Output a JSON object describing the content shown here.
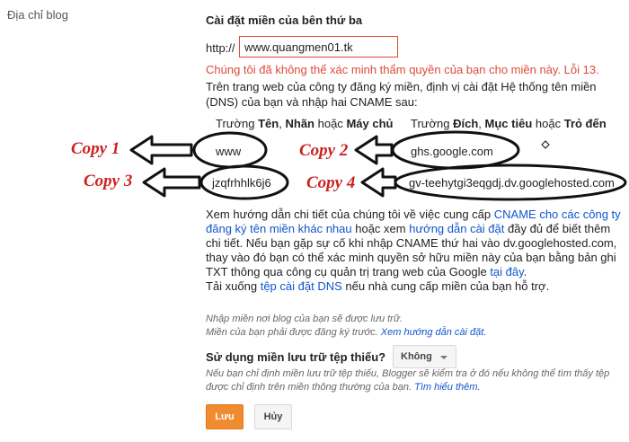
{
  "side_label": "Địa chỉ blog",
  "section_title": "Cài đặt miền của bên thứ ba",
  "http_label": "http://",
  "url_input": {
    "value": "www.quangmen01.tk"
  },
  "error_text": "Chúng tôi đã không thể xác minh thẩm quyền của bạn cho miền này. Lỗi 13.",
  "instructions": "Trên trang web của công ty đăng ký miền, định vị cài đặt Hệ thống tên miền (DNS) của bạn và nhập hai CNAME sau:",
  "table": {
    "col1_prefix": "Trường",
    "col1_b1": "Tên",
    "col1_sep1": ",",
    "col1_b2": "Nhãn",
    "col1_mid": "hoặc",
    "col1_b3": "Máy chủ",
    "col2_prefix": "Trường",
    "col2_b1": "Đích",
    "col2_sep1": ",",
    "col2_b2": "Mục tiêu",
    "col2_mid": "hoặc",
    "col2_b3": "Trỏ đến",
    "rows": [
      {
        "name": "www",
        "target": "ghs.google.com"
      },
      {
        "name": "jzqfrhhlk6j6",
        "target": "gv-teehytgi3eqgdj.dv.googlehosted.com"
      }
    ]
  },
  "annotations": {
    "copy1": "Copy 1",
    "copy2": "Copy 2",
    "copy3": "Copy 3",
    "copy4": "Copy 4"
  },
  "help": {
    "t1": "Xem hướng dẫn chi tiết của chúng tôi về việc cung cấp",
    "link1": "CNAME cho các công ty đăng ký tên miền khác nhau",
    "t2": "hoặc xem",
    "link2": "hướng dẫn cài đặt",
    "t3": "đầy đủ để biết thêm chi tiết. Nếu bạn gặp sự cố khi nhập CNAME thứ hai vào dv.googlehosted.com, thay vào đó bạn có thể xác minh quyền sở hữu miền này của bạn bằng bản ghi TXT thông qua công cụ quản trị trang web của Google",
    "link3": "tại đây",
    "t4": ".",
    "t5": "Tải xuống",
    "link4": "tệp cài đặt DNS",
    "t6": "nếu nhà cung cấp miền của bạn hỗ trợ."
  },
  "note1": "Nhập miền nơi blog của bạn sẽ được lưu trữ.",
  "note2_text": "Miền của bạn phải được đăng ký trước.",
  "note2_link": "Xem hướng dẫn cài đặt.",
  "question_label": "Sử dụng miền lưu trữ tệp thiếu?",
  "select": {
    "value": "Không"
  },
  "note3_text": "Nếu bạn chỉ định miền lưu trữ tệp thiếu, Blogger sẽ kiểm tra ở đó nếu không thể tìm thấy tệp được chỉ định trên miền thông thường của bạn.",
  "note3_link": "Tìm hiểu thêm.",
  "buttons": {
    "save": "Lưu",
    "cancel": "Hủy"
  },
  "colors": {
    "accent": "#f18b30",
    "error": "#dd4b39",
    "link": "#1155cc",
    "annotation": "#cc2222"
  }
}
